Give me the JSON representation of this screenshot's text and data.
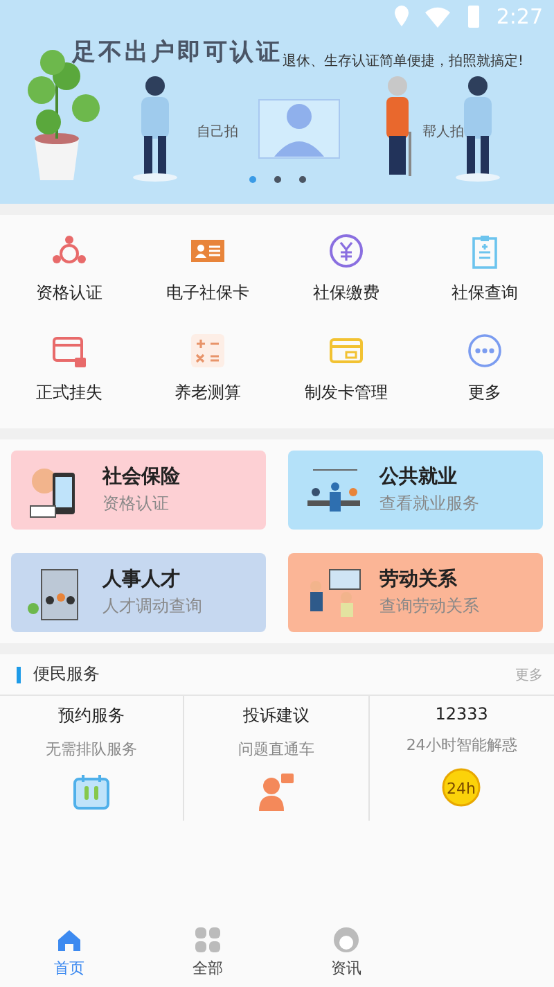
{
  "status_bar": {
    "time": "2:27"
  },
  "banner": {
    "headline": "足不出户即可认证",
    "tagline": "退休、生存认证简单便捷，拍照就搞定!",
    "left_label": "自己拍",
    "right_label": "帮人拍",
    "dots": [
      {
        "selected": true
      },
      {
        "selected": false
      },
      {
        "selected": false
      }
    ]
  },
  "services": [
    {
      "label": "资格认证"
    },
    {
      "label": "电子社保卡"
    },
    {
      "label": "社保缴费"
    },
    {
      "label": "社保查询"
    },
    {
      "label": "正式挂失"
    },
    {
      "label": "养老测算"
    },
    {
      "label": "制发卡管理"
    },
    {
      "label": "更多"
    }
  ],
  "feature_cards": [
    {
      "title": "社会保险",
      "subtitle": "资格认证",
      "color": "#fdd0d4"
    },
    {
      "title": "公共就业",
      "subtitle": "查看就业服务",
      "color": "#b4e1f9"
    },
    {
      "title": "人事人才",
      "subtitle": "人才调动查询",
      "color": "#c6d8f0"
    },
    {
      "title": "劳动关系",
      "subtitle": "查询劳动关系",
      "color": "#fbb596"
    }
  ],
  "convenience": {
    "title": "便民服务",
    "more": "更多",
    "items": [
      {
        "title": "预约服务",
        "subtitle": "无需排队服务"
      },
      {
        "title": "投诉建议",
        "subtitle": "问题直通车"
      },
      {
        "title": "12333",
        "subtitle": "24小时智能解惑",
        "badge": "24h"
      }
    ]
  },
  "tabs": [
    {
      "label": "首页",
      "selected": true
    },
    {
      "label": "全部",
      "selected": false
    },
    {
      "label": "资讯",
      "selected": false
    }
  ]
}
